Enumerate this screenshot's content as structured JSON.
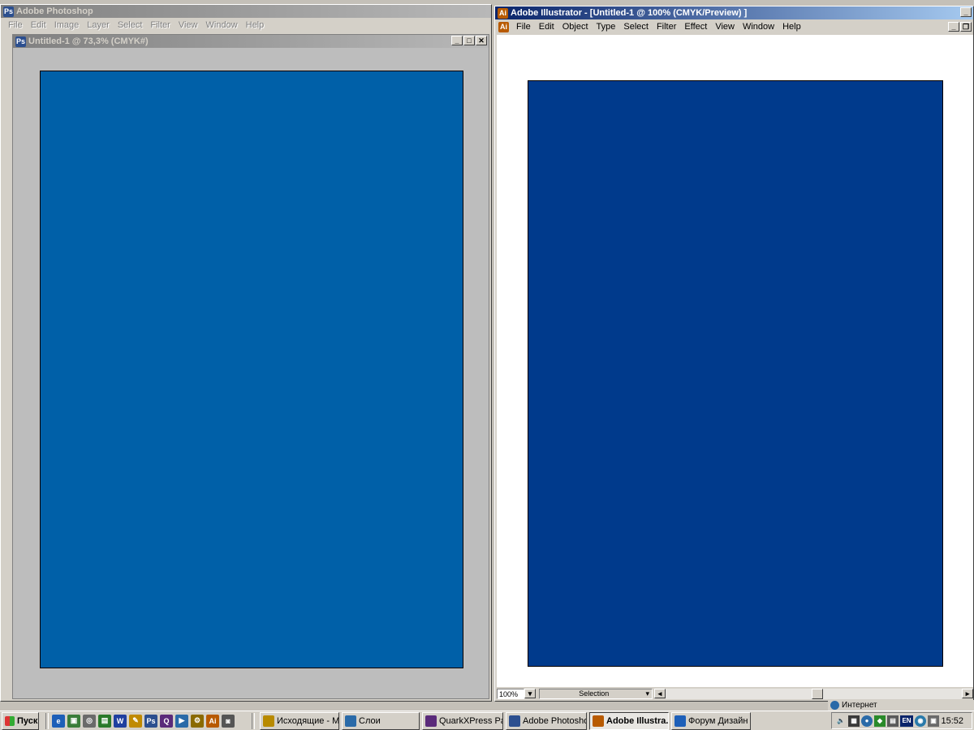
{
  "photoshop": {
    "app_title": "Adobe Photoshop",
    "menu": [
      "File",
      "Edit",
      "Image",
      "Layer",
      "Select",
      "Filter",
      "View",
      "Window",
      "Help"
    ],
    "document_title": "Untitled-1 @ 73,3% (CMYK#)",
    "canvas_color": "#0060a8"
  },
  "illustrator": {
    "app_title": "Adobe Illustrator - [Untitled-1 @ 100% (CMYK/Preview) ]",
    "menu": [
      "File",
      "Edit",
      "Object",
      "Type",
      "Select",
      "Filter",
      "Effect",
      "View",
      "Window",
      "Help"
    ],
    "artboard_color": "#003a8c",
    "status": {
      "zoom": "100%",
      "tool": "Selection"
    }
  },
  "ie_status": {
    "zone": "Интернет"
  },
  "taskbar": {
    "start_label": "Пуск",
    "quick_launch": [
      {
        "icon": "ie-icon",
        "color": "#1d5fb8",
        "glyph": "e"
      },
      {
        "icon": "desktop-icon",
        "color": "#3a7d3a",
        "glyph": "▣"
      },
      {
        "icon": "search-icon",
        "color": "#6a6a6a",
        "glyph": "◎"
      },
      {
        "icon": "image-icon",
        "color": "#2a7a2a",
        "glyph": "▤"
      },
      {
        "icon": "word-icon",
        "color": "#1f3f9f",
        "glyph": "W"
      },
      {
        "icon": "pencil-icon",
        "color": "#c08a00",
        "glyph": "✎"
      },
      {
        "icon": "photoshop-icon",
        "color": "#2c4f8f",
        "glyph": "Ps"
      },
      {
        "icon": "quark-icon",
        "color": "#5a2a7a",
        "glyph": "Q"
      },
      {
        "icon": "media-icon",
        "color": "#2a6aa8",
        "glyph": "▶"
      },
      {
        "icon": "acrobat-icon",
        "color": "#8a6a00",
        "glyph": "⚙"
      },
      {
        "icon": "illustrator-icon",
        "color": "#b85a00",
        "glyph": "Ai"
      },
      {
        "icon": "gimp-icon",
        "color": "#555555",
        "glyph": "◙"
      }
    ],
    "buttons": [
      {
        "label": "Исходящие - Mi...",
        "icon": "outlook-icon",
        "color": "#b88a00",
        "active": false
      },
      {
        "label": "Слои",
        "icon": "layers-icon",
        "color": "#2a6aa8",
        "active": false
      },
      {
        "label": "QuarkXPress Pa...",
        "icon": "quark-icon",
        "color": "#5a2a7a",
        "active": false
      },
      {
        "label": "Adobe Photoshop",
        "icon": "photoshop-icon",
        "color": "#2c4f8f",
        "active": false
      },
      {
        "label": "Adobe Illustra...",
        "icon": "illustrator-icon",
        "color": "#b85a00",
        "active": true
      },
      {
        "label": "Форум Дизайн ...",
        "icon": "ie-icon",
        "color": "#1d5fb8",
        "active": false
      }
    ],
    "tray": {
      "lang": "EN",
      "time": "15:52"
    }
  }
}
